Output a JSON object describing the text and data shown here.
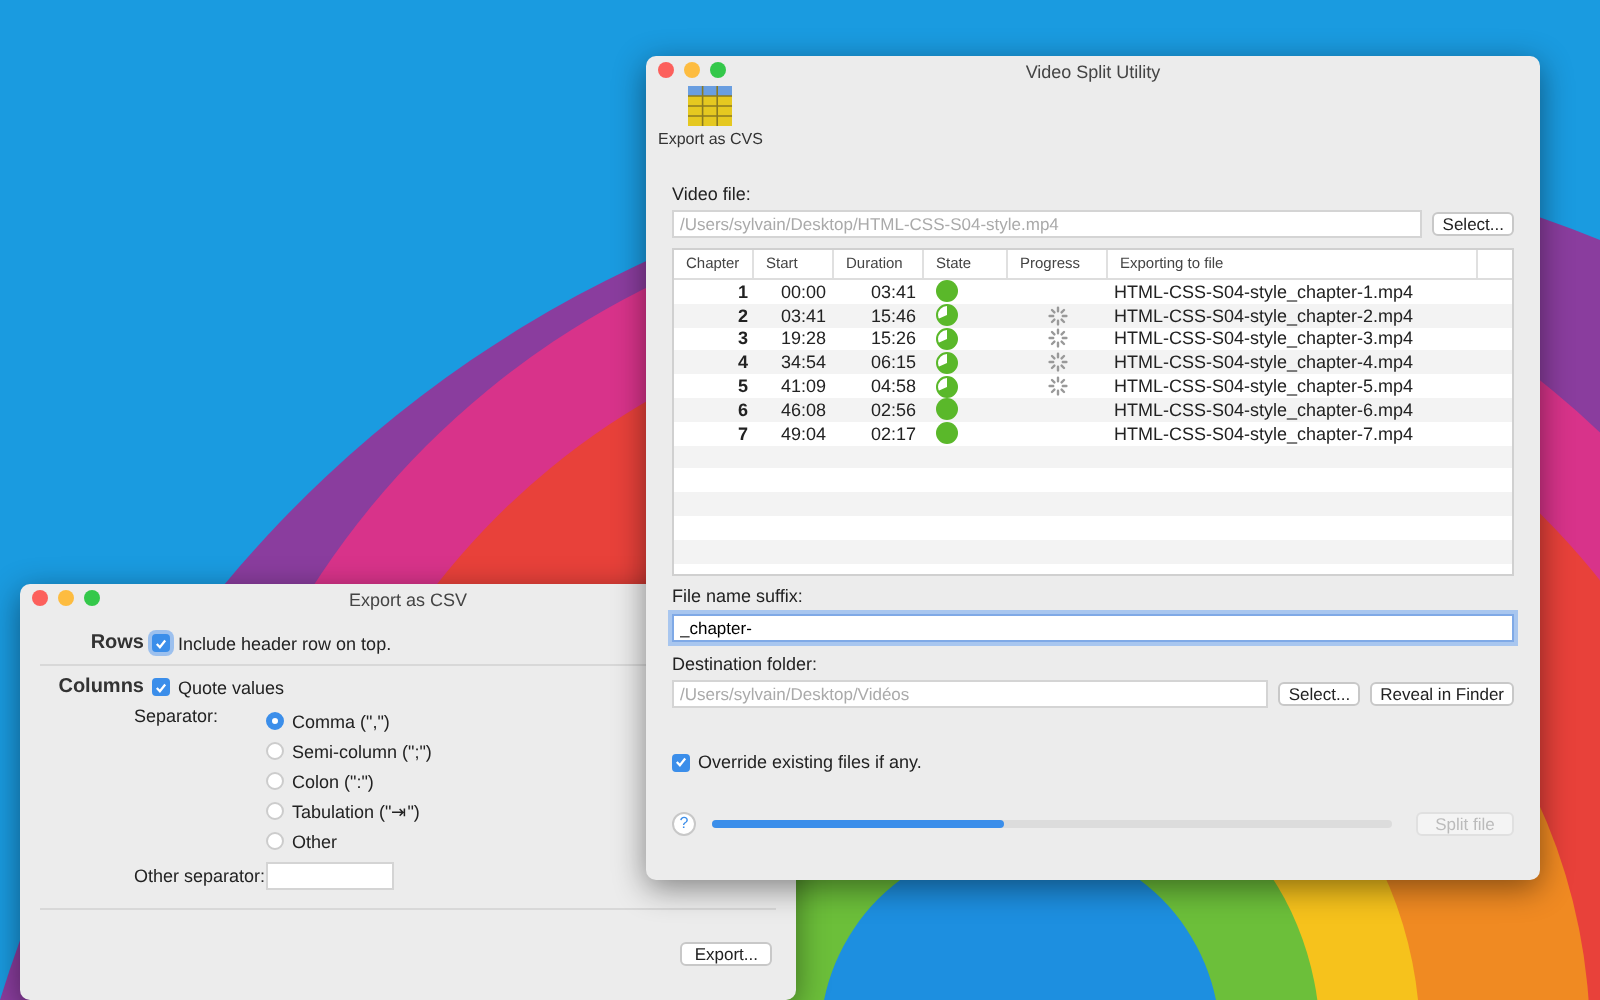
{
  "main_window": {
    "title": "Video Split Utility",
    "toolbar": [
      {
        "label": "Export as CVS"
      }
    ],
    "video_file": {
      "label": "Video file:",
      "placeholder": "/Users/sylvain/Desktop/HTML-CSS-S04-style.mp4",
      "button": "Select..."
    },
    "table": {
      "columns": [
        "Chapter",
        "Start",
        "Duration",
        "State",
        "Progress",
        "Exporting to file"
      ],
      "rows": [
        {
          "chapter": "1",
          "start": "00:00",
          "duration": "03:41",
          "done": true,
          "file": "HTML-CSS-S04-style_chapter-1.mp4"
        },
        {
          "chapter": "2",
          "start": "03:41",
          "duration": "15:46",
          "done": false,
          "file": "HTML-CSS-S04-style_chapter-2.mp4"
        },
        {
          "chapter": "3",
          "start": "19:28",
          "duration": "15:26",
          "done": false,
          "file": "HTML-CSS-S04-style_chapter-3.mp4"
        },
        {
          "chapter": "4",
          "start": "34:54",
          "duration": "06:15",
          "done": false,
          "file": "HTML-CSS-S04-style_chapter-4.mp4"
        },
        {
          "chapter": "5",
          "start": "41:09",
          "duration": "04:58",
          "done": false,
          "file": "HTML-CSS-S04-style_chapter-5.mp4"
        },
        {
          "chapter": "6",
          "start": "46:08",
          "duration": "02:56",
          "done": true,
          "file": "HTML-CSS-S04-style_chapter-6.mp4"
        },
        {
          "chapter": "7",
          "start": "49:04",
          "duration": "02:17",
          "done": true,
          "file": "HTML-CSS-S04-style_chapter-7.mp4"
        }
      ]
    },
    "suffix": {
      "label": "File name suffix:",
      "value": "_chapter-"
    },
    "destination": {
      "label": "Destination folder:",
      "placeholder": "/Users/sylvain/Desktop/Vidéos",
      "buttons": [
        "Select...",
        "Reveal in Finder"
      ]
    },
    "override": {
      "label": "Override existing files if any.",
      "checked": true
    },
    "help": "?",
    "progress": {
      "level": 0.43
    },
    "split_button": {
      "label": "Split file",
      "disabled": true
    }
  },
  "csv_window": {
    "title": "Export as CSV",
    "rows_section": {
      "label": "Rows",
      "option": {
        "label": "Include header row on top.",
        "checked": true
      }
    },
    "columns_section": {
      "label": "Columns",
      "option": {
        "label": "Quote values",
        "checked": true
      }
    },
    "separator_label": "Separator:",
    "separators": [
      {
        "label": "Comma (\",\")",
        "selected": true
      },
      {
        "label": "Semi-column (\";\")",
        "selected": false
      },
      {
        "label": "Colon (\":\")",
        "selected": false
      },
      {
        "label": "Tabulation (\"⇥\")",
        "selected": false
      },
      {
        "label": "Other",
        "selected": false
      }
    ],
    "other_separator": {
      "label": "Other separator:"
    },
    "export_button": "Export..."
  }
}
